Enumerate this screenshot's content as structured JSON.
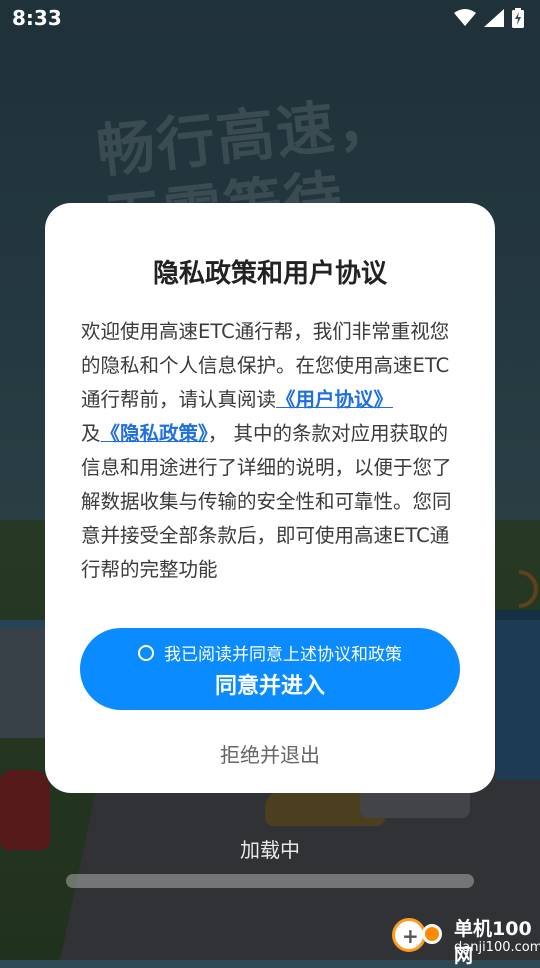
{
  "status_bar": {
    "time": "8:33",
    "icons": [
      "wifi-icon",
      "signal-icon",
      "battery-charging-icon"
    ]
  },
  "background": {
    "slogan_line1": "畅行高速，",
    "slogan_line2": "无需等待"
  },
  "dialog": {
    "title": "隐私政策和用户协议",
    "body_intro": "欢迎使用高速ETC通行帮，我们非常重视您的隐私和个人信息保护。在您使用高速ETC通行帮前，请认真阅读",
    "user_agreement_link": "《用户协议》",
    "and_text": "及",
    "privacy_policy_link": "《隐私政策》",
    "body_rest": "， 其中的条款对应用获取的信息和用途进行了详细的说明，以便于您了解数据收集与传输的安全性和可靠性。您同意并接受全部条款后，即可使用高速ETC通行帮的完整功能",
    "agree_checkbox_label": "我已阅读并同意上述协议和政策",
    "agree_button_label": "同意并进入",
    "reject_label": "拒绝并退出"
  },
  "loading": {
    "label": "加载中",
    "progress": 0
  },
  "watermark": {
    "name": "单机100网",
    "url": "danji100.com"
  },
  "colors": {
    "accent": "#0a8bff",
    "link": "#1f6fe0"
  }
}
